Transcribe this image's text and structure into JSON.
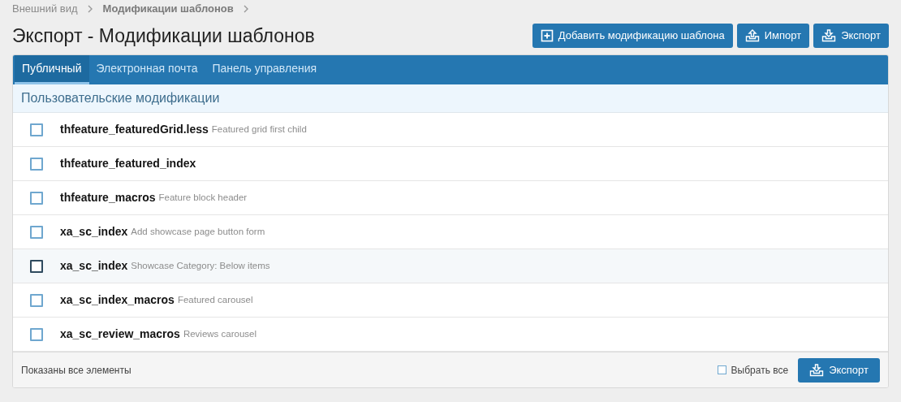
{
  "breadcrumb": [
    {
      "label": "Внешний вид",
      "current": false
    },
    {
      "label": "Модификации шаблонов",
      "current": true
    }
  ],
  "title": "Экспорт - Модификации шаблонов",
  "actions": [
    {
      "label": "Добавить модификацию шаблона",
      "kind": "add"
    },
    {
      "label": "Импорт",
      "kind": "import"
    },
    {
      "label": "Экспорт",
      "kind": "export"
    }
  ],
  "tabs": [
    {
      "label": "Публичный",
      "selected": true
    },
    {
      "label": "Электронная почта",
      "selected": false
    },
    {
      "label": "Панель управления",
      "selected": false
    }
  ],
  "section_title": "Пользовательские модификации",
  "rows": [
    {
      "template": "thfeature_featuredGrid.less",
      "description": "Featured grid first child",
      "checked": false,
      "hovered": false
    },
    {
      "template": "thfeature_featured_index",
      "checked": false,
      "hovered": false
    },
    {
      "template": "thfeature_macros",
      "description": "Feature block header",
      "checked": false,
      "hovered": false
    },
    {
      "template": "xa_sc_index",
      "description": "Add showcase page button form",
      "checked": false,
      "hovered": false
    },
    {
      "template": "xa_sc_index",
      "description": "Showcase Category: Below items",
      "checked": false,
      "hovered": true
    },
    {
      "template": "xa_sc_index_macros",
      "description": "Featured carousel",
      "checked": false,
      "hovered": false
    },
    {
      "template": "xa_sc_review_macros",
      "description": "Reviews carousel",
      "checked": false,
      "hovered": false
    }
  ],
  "footer": {
    "status": "Показаны все элементы",
    "select_all": {
      "label": "Выбрать все",
      "checked": false
    },
    "submit": "Экспорт"
  }
}
